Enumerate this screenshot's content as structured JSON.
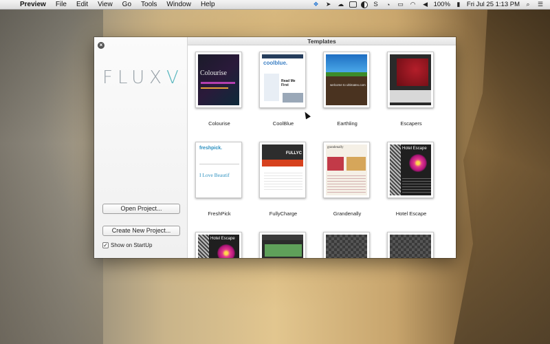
{
  "menubar": {
    "app_name": "Preview",
    "items": [
      "File",
      "Edit",
      "View",
      "Go",
      "Tools",
      "Window",
      "Help"
    ],
    "status": {
      "s_label": "S",
      "battery": "100%",
      "datetime": "Fri Jul 25  1:13 PM"
    }
  },
  "window": {
    "logo_text": "FLUX",
    "logo_accent": "V",
    "open_project_label": "Open Project...",
    "new_project_label": "Create New Project...",
    "startup_label": "Show on StartUp",
    "startup_checked": true,
    "templates_title": "Templates",
    "thumb_text": {
      "colourise": "Colourise",
      "coolblue": "coolblue.",
      "coolblue_sub": "Read Me First",
      "earthling": "welcome to ultimatex.com",
      "freshpick": "freshpick.",
      "freshpick_big": "I Love Beautif",
      "fullycharge": "FULLYC",
      "grandenally": "grandenally",
      "hotel": "Hotel Escape"
    },
    "templates": [
      {
        "name": "Colourise"
      },
      {
        "name": "CoolBlue"
      },
      {
        "name": "Earthling"
      },
      {
        "name": "Escapers"
      },
      {
        "name": "FreshPick"
      },
      {
        "name": "FullyCharge"
      },
      {
        "name": "Grandenally"
      },
      {
        "name": "Hotel Escape"
      }
    ]
  },
  "colors": {
    "accent": "#5db8c0",
    "window_bg": "#ffffff",
    "sidebar_bg": "#f0f0f0"
  }
}
